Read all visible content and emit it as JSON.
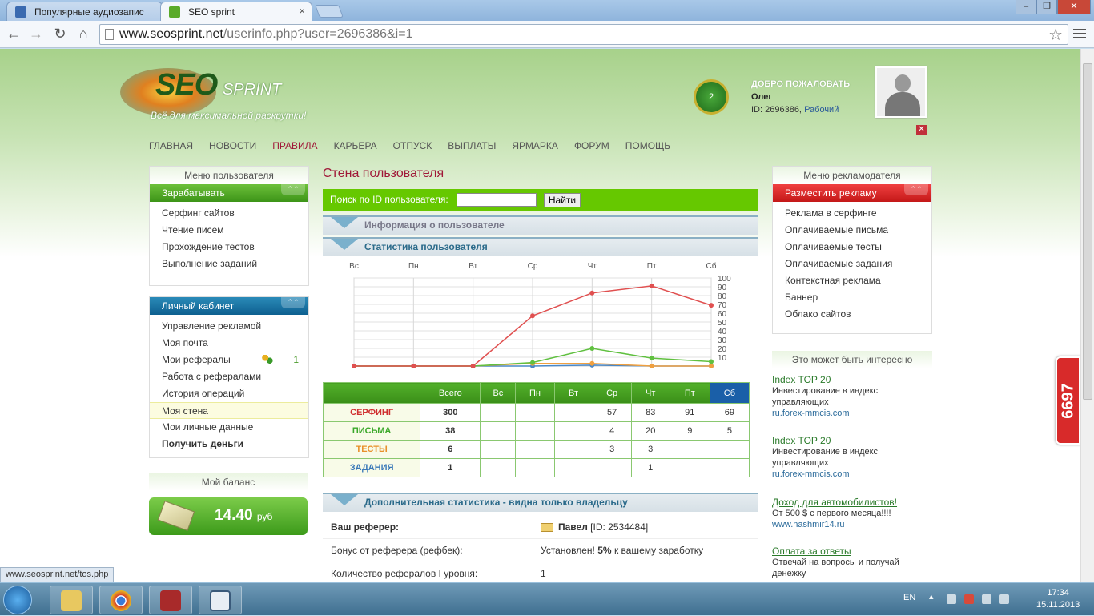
{
  "browser": {
    "tabs": [
      {
        "title": "Популярные аудиозапис",
        "active": false
      },
      {
        "title": "SEO sprint",
        "active": true
      }
    ],
    "url_host": "www.seosprint.net",
    "url_path": "/userinfo.php?user=2696386&i=1",
    "status_url": "www.seosprint.net/tos.php"
  },
  "header": {
    "logo_seo": "SEO",
    "logo_sprint": "SPRINT",
    "tagline": "Всё для максимальной раскрутки!",
    "level": "2",
    "welcome": "ДОБРО ПОЖАЛОВАТЬ",
    "username": "Олег",
    "id_text": "ID: 2696386,",
    "role": "Рабочий",
    "close_symbol": "✕"
  },
  "topnav": [
    "ГЛАВНАЯ",
    "НОВОСТИ",
    "ПРАВИЛА",
    "КАРЬЕРА",
    "ОТПУСК",
    "ВЫПЛАТЫ",
    "ЯРМАРКА",
    "ФОРУМ",
    "ПОМОЩЬ"
  ],
  "left": {
    "user_menu_title": "Меню пользователя",
    "earn": {
      "title": "Зарабатывать",
      "items": [
        "Серфинг сайтов",
        "Чтение писем",
        "Прохождение тестов",
        "Выполнение заданий"
      ]
    },
    "cabinet": {
      "title": "Личный кабинет",
      "items": [
        "Управление рекламой",
        "Моя почта",
        "Мои рефералы",
        "Работа с рефералами",
        "История операций",
        "Моя стена",
        "Мои личные данные",
        "Получить деньги"
      ],
      "referrals_count": "1"
    },
    "balance_title": "Мой баланс",
    "balance_amount": "14.40",
    "balance_currency": "руб"
  },
  "center": {
    "title": "Стена пользователя",
    "search_label": "Поиск по ID пользователя:",
    "search_value": "",
    "search_button": "Найти",
    "section_info": "Информация о пользователе",
    "section_stats": "Статистика пользователя",
    "section_extra": "Дополнительная статистика - видна только владельцу",
    "table": {
      "headers": [
        "",
        "Всего",
        "Вс",
        "Пн",
        "Вт",
        "Ср",
        "Чт",
        "Пт",
        "Сб"
      ],
      "rows": [
        {
          "label": "СЕРФИНГ",
          "color": "#d03030",
          "cells": [
            "300",
            "",
            "",
            "",
            "57",
            "83",
            "91",
            "69"
          ]
        },
        {
          "label": "ПИСЬМА",
          "color": "#3aa82a",
          "cells": [
            "38",
            "",
            "",
            "",
            "4",
            "20",
            "9",
            "5"
          ]
        },
        {
          "label": "ТЕСТЫ",
          "color": "#e8902a",
          "cells": [
            "6",
            "",
            "",
            "",
            "3",
            "3",
            "",
            ""
          ]
        },
        {
          "label": "ЗАДАНИЯ",
          "color": "#3a78b8",
          "cells": [
            "1",
            "",
            "",
            "",
            "",
            "1",
            "",
            ""
          ]
        }
      ]
    },
    "info_rows": [
      {
        "key": "Ваш реферер:",
        "value_name": "Павел",
        "value_rest": "[ID: 2534484]"
      },
      {
        "key": "Бонус от реферера (рефбек):",
        "value_pre": "Установлен!",
        "value_bold": "5%",
        "value_post": "к вашему заработку"
      },
      {
        "key": "Количество рефералов I уровня:",
        "value": "1"
      }
    ]
  },
  "chart_data": {
    "type": "line",
    "categories": [
      "Вс",
      "Пн",
      "Вт",
      "Ср",
      "Чт",
      "Пт",
      "Сб"
    ],
    "ylim": [
      0,
      100
    ],
    "yticks": [
      10,
      20,
      30,
      40,
      50,
      60,
      70,
      80,
      90,
      100
    ],
    "grid": true,
    "series": [
      {
        "name": "СЕРФИНГ",
        "color": "#e05050",
        "values": [
          0,
          0,
          0,
          57,
          83,
          91,
          69
        ]
      },
      {
        "name": "ПИСЬМА",
        "color": "#60c040",
        "values": [
          0,
          0,
          0,
          4,
          20,
          9,
          5
        ]
      },
      {
        "name": "ТЕСТЫ",
        "color": "#f0a040",
        "values": [
          0,
          0,
          0,
          3,
          3,
          0,
          0
        ]
      },
      {
        "name": "ЗАДАНИЯ",
        "color": "#4a88c8",
        "values": [
          0,
          0,
          0,
          0,
          1,
          0,
          0
        ]
      }
    ]
  },
  "right": {
    "adv_menu_title": "Меню рекламодателя",
    "place_ad": {
      "title": "Разместить рекламу",
      "items": [
        "Реклама в серфинге",
        "Оплачиваемые письма",
        "Оплачиваемые тесты",
        "Оплачиваемые задания",
        "Контекстная реклама",
        "Баннер",
        "Облако сайтов"
      ]
    },
    "interesting_title": "Это может быть интересно",
    "ads": [
      {
        "title": "Index TOP 20",
        "desc": "Инвестирование в индекс управляющих",
        "url": "ru.forex-mmcis.com"
      },
      {
        "title": "Index TOP 20",
        "desc": "Инвестирование в индекс управляющих",
        "url": "ru.forex-mmcis.com"
      },
      {
        "title": "Доход для автомобилистов!",
        "desc": "От 500 $ с первого месяца!!!!",
        "url": "www.nashmir14.ru"
      },
      {
        "title": "Оплата за ответы",
        "desc": "Отвечай на вопросы и получай денежку",
        "url": ""
      }
    ],
    "badge": "6697"
  },
  "taskbar": {
    "lang": "EN",
    "time": "17:34",
    "date": "15.11.2013"
  }
}
